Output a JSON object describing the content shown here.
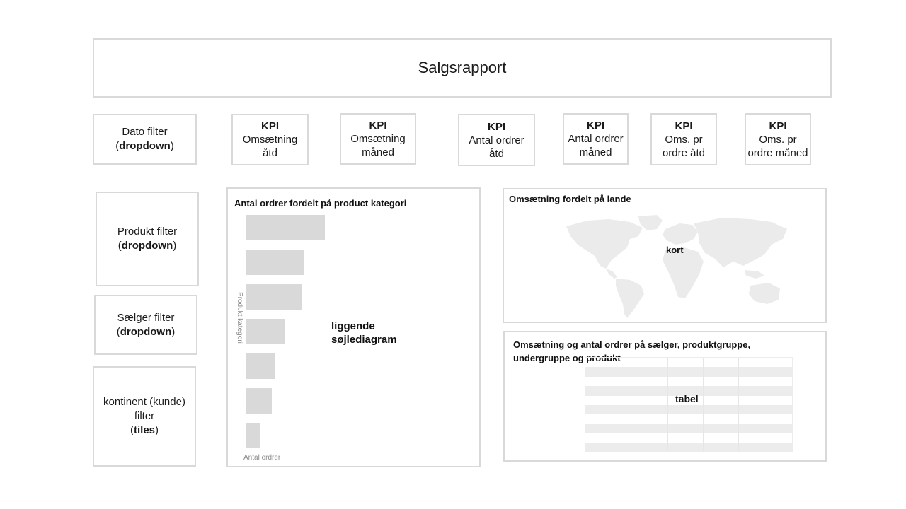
{
  "title": "Salgsrapport",
  "filters": {
    "dato": {
      "name": "Dato filter",
      "type": "dropdown"
    },
    "produkt": {
      "name": "Produkt filter",
      "type": "dropdown"
    },
    "saelger": {
      "name": "Sælger filter",
      "type": "dropdown"
    },
    "kontinent": {
      "name_line1": "kontinent (kunde)",
      "name_line2": "filter",
      "type": "tiles"
    }
  },
  "kpis": [
    {
      "head": "KPI",
      "line1": "Omsætning",
      "line2": "åtd"
    },
    {
      "head": "KPI",
      "line1": "Omsætning",
      "line2": "måned"
    },
    {
      "head": "KPI",
      "line1": "Antal ordrer",
      "line2": "åtd"
    },
    {
      "head": "KPI",
      "line1": "Antal ordrer",
      "line2": "måned"
    },
    {
      "head": "KPI",
      "line1": "Oms. pr",
      "line2": "ordre åtd"
    },
    {
      "head": "KPI",
      "line1": "Oms. pr",
      "line2": "ordre måned"
    }
  ],
  "bar_panel": {
    "title": "Antal ordrer fordelt på product kategori",
    "note_line1": "liggende",
    "note_line2": "søjlediagram"
  },
  "map_panel": {
    "title": "Omsætning fordelt på lande",
    "note": "kort"
  },
  "table_panel": {
    "title_line1": "Omsætning og antal ordrer på sælger, produktgruppe,",
    "title_line2": "undergruppe og produkt",
    "note": "tabel"
  },
  "chart_data": {
    "type": "bar",
    "orientation": "horizontal",
    "categories": [],
    "values": [
      112,
      83,
      79,
      55,
      41,
      37,
      21
    ],
    "xlabel": "Antal ordrer",
    "ylabel": "Produkt kategori",
    "grid": false
  },
  "colors": {
    "border": "#d9d9d9",
    "bar": "#d9d9d9",
    "map": "#ebebeb",
    "table_stripe": "#ececec"
  }
}
